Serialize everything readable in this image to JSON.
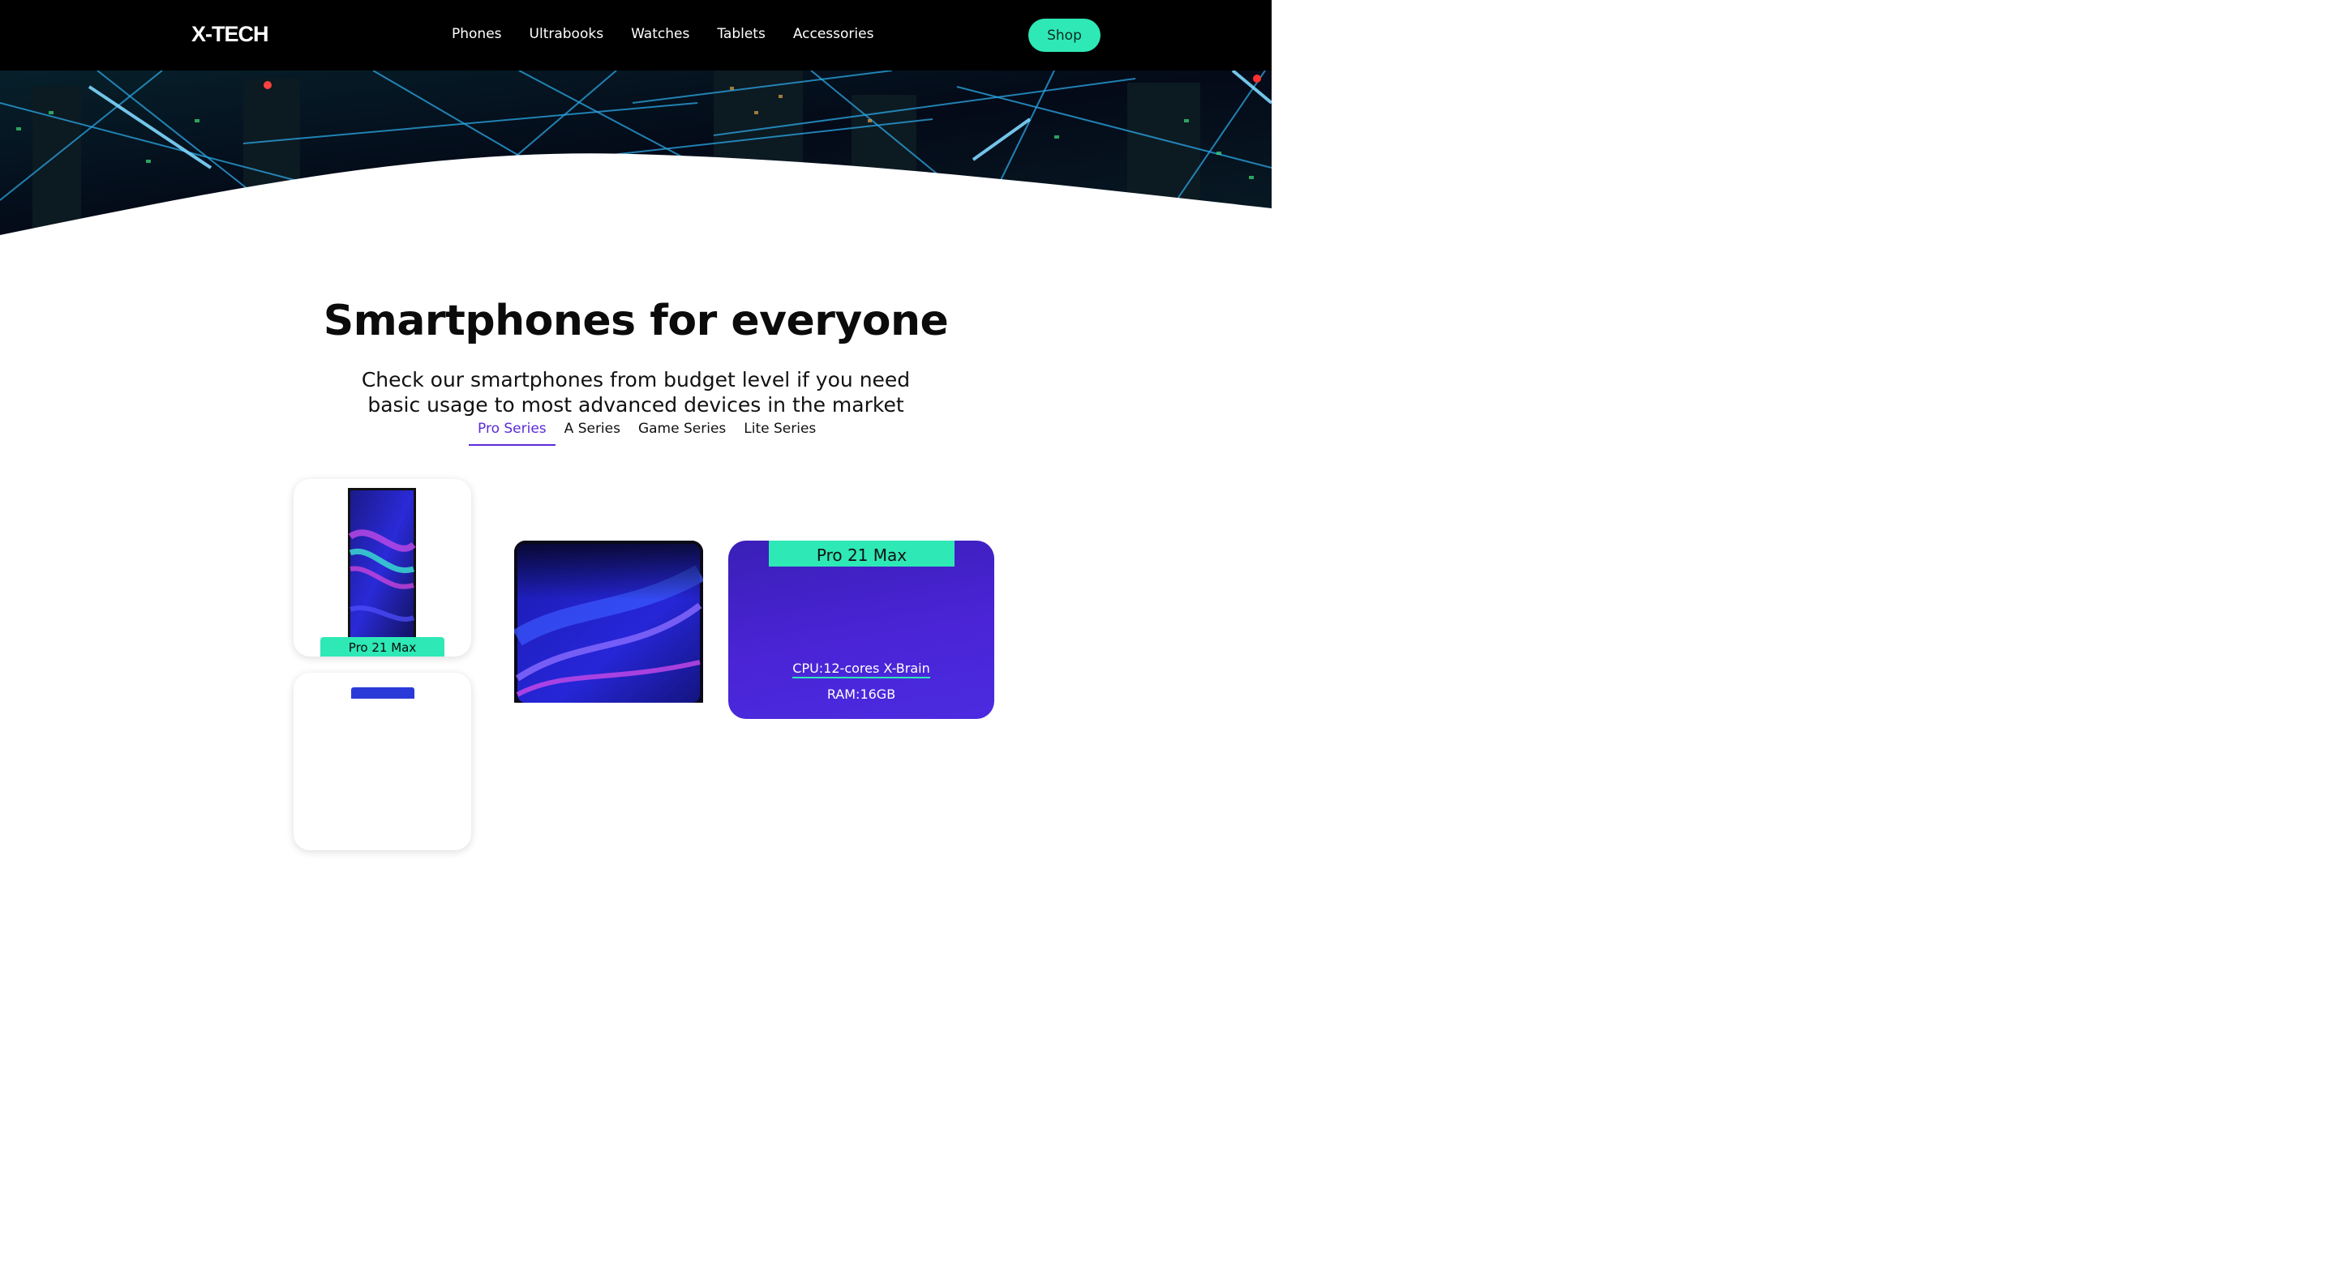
{
  "brand": {
    "logo": "X-TECH"
  },
  "nav": {
    "items": [
      "Phones",
      "Ultrabooks",
      "Watches",
      "Tablets",
      "Accessories"
    ],
    "shop_label": "Shop"
  },
  "colors": {
    "accent": "#2ee8b6",
    "active_tab": "#5b2bd6",
    "card_purple": "#4a24d6"
  },
  "section": {
    "title": "Smartphones for everyone",
    "subtitle": "Check our smartphones from budget level if you need basic usage to most advanced devices in the market"
  },
  "tabs": {
    "items": [
      "Pro Series",
      "A Series",
      "Game Series",
      "Lite Series"
    ],
    "active": "Pro Series"
  },
  "products": {
    "thumb_label": "Pro 21 Max",
    "spec_card": {
      "title": "Pro 21 Max",
      "cpu": "CPU:12-cores X-Brain",
      "ram": "RAM:16GB"
    }
  }
}
